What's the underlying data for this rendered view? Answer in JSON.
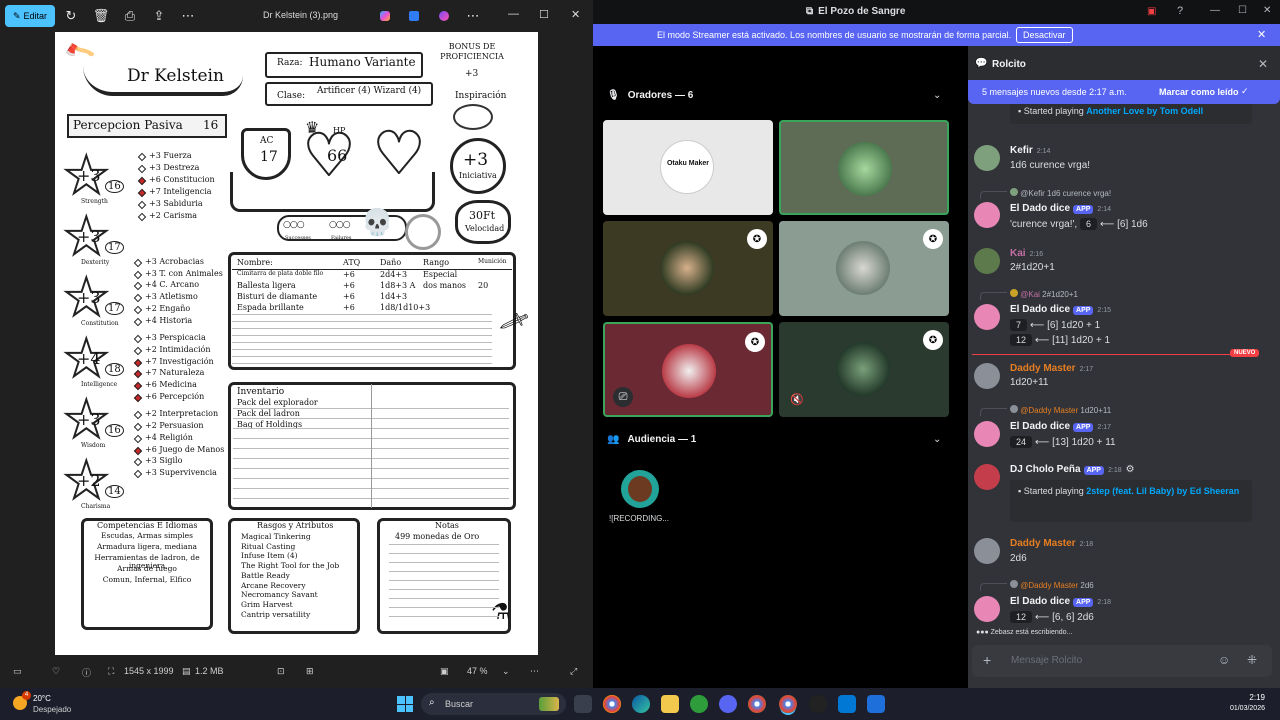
{
  "photos": {
    "edit_label": "Editar",
    "file_title": "Dr Kelstein (3).png",
    "dimensions": "1545 x 1999",
    "filesize": "1.2 MB",
    "zoom": "47 %"
  },
  "sheet": {
    "name": "Dr Kelstein",
    "race_label": "Raza:",
    "race": "Humano Variante",
    "class_label": "Clase:",
    "class": "Artificer (4) Wizard (4)",
    "prof_bonus_label": "BONUS DE PROFICIENCIA",
    "prof_bonus": "+3",
    "inspiration": "Inspiración",
    "passive_label": "Percepcion Pasiva",
    "passive": "16",
    "ac_label": "AC",
    "ac": "17",
    "hp_label": "HP",
    "hp": "66",
    "initiative": "+3",
    "initiative_label": "Iniciativa",
    "speed": "30Ft",
    "speed_label": "Velocidad",
    "successes": "Successes",
    "failures": "Failures",
    "abilities": [
      {
        "mod": "+3",
        "score": "16",
        "label": "Strength"
      },
      {
        "mod": "+3",
        "score": "17",
        "label": "Dexterity"
      },
      {
        "mod": "+3",
        "score": "17",
        "label": "Constitution"
      },
      {
        "mod": "+4",
        "score": "18",
        "label": "Intelligence"
      },
      {
        "mod": "+3",
        "score": "16",
        "label": "Wisdom"
      },
      {
        "mod": "+2",
        "score": "14",
        "label": "Charisma"
      }
    ],
    "saves": [
      "+3 Fuerza",
      "+3 Destreza",
      "+6 Constitucion",
      "+7 Inteligencia",
      "+3 Sabiduria",
      "+2 Carisma"
    ],
    "skills": [
      "+3 Acrobacias",
      "+3 T. con Animales",
      "+4 C. Arcano",
      "+3 Atletismo",
      "+2 Engaño",
      "+4 Historia",
      "+3 Perspicacia",
      "+2 Intimidación",
      "+7 Investigación",
      "+7 Naturaleza",
      "+6 Medicina",
      "+6 Percepción",
      "+2 Interpretacion",
      "+2 Persuasion",
      "+4 Religión",
      "+6 Juego de Manos",
      "+3 Sigilo",
      "+3 Supervivencia"
    ],
    "weapons_header": [
      "Nombre:",
      "ATQ",
      "Daño",
      "Rango",
      "Munición"
    ],
    "weapons": [
      [
        "Cimitarra de plata doble filo",
        "+6",
        "2d4+3",
        "Especial",
        ""
      ],
      [
        "Ballesta ligera",
        "+6",
        "1d8+3 A",
        "dos manos",
        "20"
      ],
      [
        "Bisturi de diamante",
        "+6",
        "1d4+3",
        "",
        ""
      ],
      [
        "Espada brillante",
        "+6",
        "1d8/1d10+3",
        "",
        ""
      ]
    ],
    "inventory_label": "Inventario",
    "inventory": [
      "Pack del explorador",
      "Pack del ladron",
      "Bag of Holdings"
    ],
    "competencies_label": "Competencias E Idiomas",
    "competencies": [
      "Escudas, Armas simples",
      "Armadura ligera, mediana",
      "Herramientas de ladron, de ingeniera",
      "Armas de fuego",
      "Comun, Infernal, Elfico"
    ],
    "traits_label": "Rasgos y Atributos",
    "traits": [
      "Magical Tinkering",
      "Ritual Casting",
      "Infuse Item (4)",
      "The Right Tool for the Job",
      "Battle Ready",
      "Arcane Recovery",
      "Necromancy Savant",
      "Grim Harvest",
      "Cantrip versatility"
    ],
    "notes_label": "Notas",
    "notes": [
      "499 monedas de Oro"
    ]
  },
  "discord": {
    "window_title": "El Pozo de Sangre",
    "banner_text": "El modo Streamer está activado. Los nombres de usuario se mostrarán de forma parcial.",
    "banner_button": "Desactivar",
    "speakers_label": "Oradores — 6",
    "audience_label": "Audiencia — 1",
    "audience_member": "![RECORDING...",
    "tile_text": "Otaku Maker",
    "chat_title": "Rolcito",
    "new_messages": "5 mensajes nuevos desde 2:17 a.m.",
    "mark_read": "Marcar como leído",
    "new_label": "NUEVO",
    "typing": "Zebasz está escribiendo...",
    "composer_placeholder": "Mensaje Rolcito",
    "messages": {
      "m0_embed": "Started playing",
      "m0_link": "Another Love by Tom Odell",
      "m1_user": "Kefir",
      "m1_time": "2:14",
      "m1_text": "1d6 curence vrga!",
      "m2_reply_user": "@Kefir",
      "m2_reply_text": "1d6 curence vrga!",
      "m2_user": "El Dado dice",
      "m2_app": "APP",
      "m2_time": "2:14",
      "m2_pre": "'curence vrga!',",
      "m2_num": "6",
      "m2_post": "⟵ [6] 1d6",
      "m3_user": "Kai",
      "m3_time": "2:16",
      "m3_text": "2#1d20+1",
      "m4_reply_user": "@Kai",
      "m4_reply_text": "2#1d20+1",
      "m4_user": "El Dado dice",
      "m4_app": "APP",
      "m4_time": "2:15",
      "m4_num1": "7",
      "m4_post1": "⟵ [6] 1d20 + 1",
      "m4_num2": "12",
      "m4_post2": "⟵ [11] 1d20 + 1",
      "m5_user": "Daddy Master",
      "m5_time": "2:17",
      "m5_text": "1d20+11",
      "m6_reply_user": "@Daddy Master",
      "m6_reply_text": "1d20+11",
      "m6_user": "El Dado dice",
      "m6_app": "APP",
      "m6_time": "2:17",
      "m6_num": "24",
      "m6_post": "⟵ [13] 1d20 + 11",
      "m7_user": "DJ Cholo Peña",
      "m7_app": "APP",
      "m7_time": "2:18",
      "m7_embed": "Started playing",
      "m7_link": "2step (feat. Lil Baby) by Ed Sheeran",
      "m8_user": "Daddy Master",
      "m8_time": "2:18",
      "m8_text": "2d6",
      "m9_reply_user": "@Daddy Master",
      "m9_reply_text": "2d6",
      "m9_user": "El Dado dice",
      "m9_app": "APP",
      "m9_time": "2:18",
      "m9_num": "12",
      "m9_post": "⟵ [6, 6] 2d6"
    }
  },
  "taskbar": {
    "temp": "20°C",
    "weather": "Despejado",
    "search": "Buscar",
    "time": "2:19",
    "date": "01/03/2026",
    "weather_badge": "4"
  },
  "colors": {
    "discord_blurple": "#5865f2",
    "streamer_banner": "#5865f2",
    "speaking_border": "#3ba55c",
    "new_red": "#f23f43",
    "photos_accent": "#4cc2ff"
  }
}
